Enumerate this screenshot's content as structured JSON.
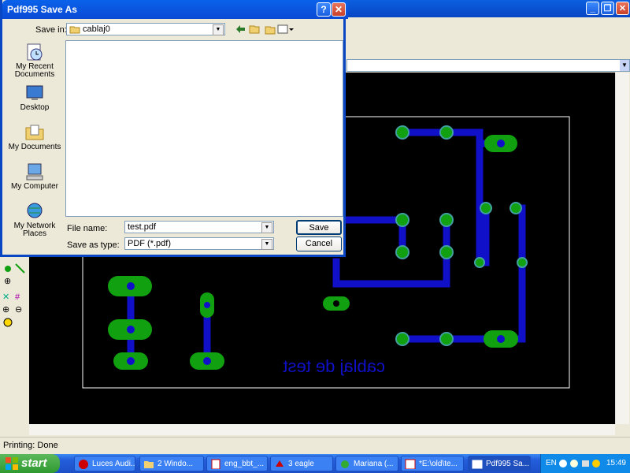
{
  "dialog": {
    "title": "Pdf995 Save As",
    "save_in_label": "Save in:",
    "save_in_value": "cablaj0",
    "file_name_label": "File name:",
    "file_name_value": "test.pdf",
    "save_as_type_label": "Save as type:",
    "save_as_type_value": "PDF (*.pdf)",
    "save_button": "Save",
    "cancel_button": "Cancel",
    "places": [
      {
        "label": "My Recent Documents",
        "icon": "recent-documents-icon"
      },
      {
        "label": "Desktop",
        "icon": "desktop-icon"
      },
      {
        "label": "My Documents",
        "icon": "my-documents-icon"
      },
      {
        "label": "My Computer",
        "icon": "my-computer-icon"
      },
      {
        "label": "My Network Places",
        "icon": "network-places-icon"
      }
    ]
  },
  "board": {
    "label": "cablaj de test",
    "colors": {
      "canvas": "#000000",
      "trace": "#1010c8",
      "pad": "#10a010",
      "pad_ring": "#40a0a0",
      "outline": "#ffffff"
    }
  },
  "status": {
    "text": "Printing: Done"
  },
  "taskbar": {
    "start": "start",
    "tasks": [
      {
        "label": "Luces Audi...",
        "icon": "opera-icon"
      },
      {
        "label": "2 Windo...",
        "icon": "folder-icon"
      },
      {
        "label": "eng_bbt_...",
        "icon": "pdf-icon"
      },
      {
        "label": "3 eagle",
        "icon": "eagle-icon"
      },
      {
        "label": "Mariana (...",
        "icon": "messenger-icon"
      },
      {
        "label": "*E:\\old\\te...",
        "icon": "editor-icon"
      },
      {
        "label": "Pdf995 Sa...",
        "icon": "window-icon"
      }
    ],
    "language": "EN",
    "clock": "15:49"
  }
}
